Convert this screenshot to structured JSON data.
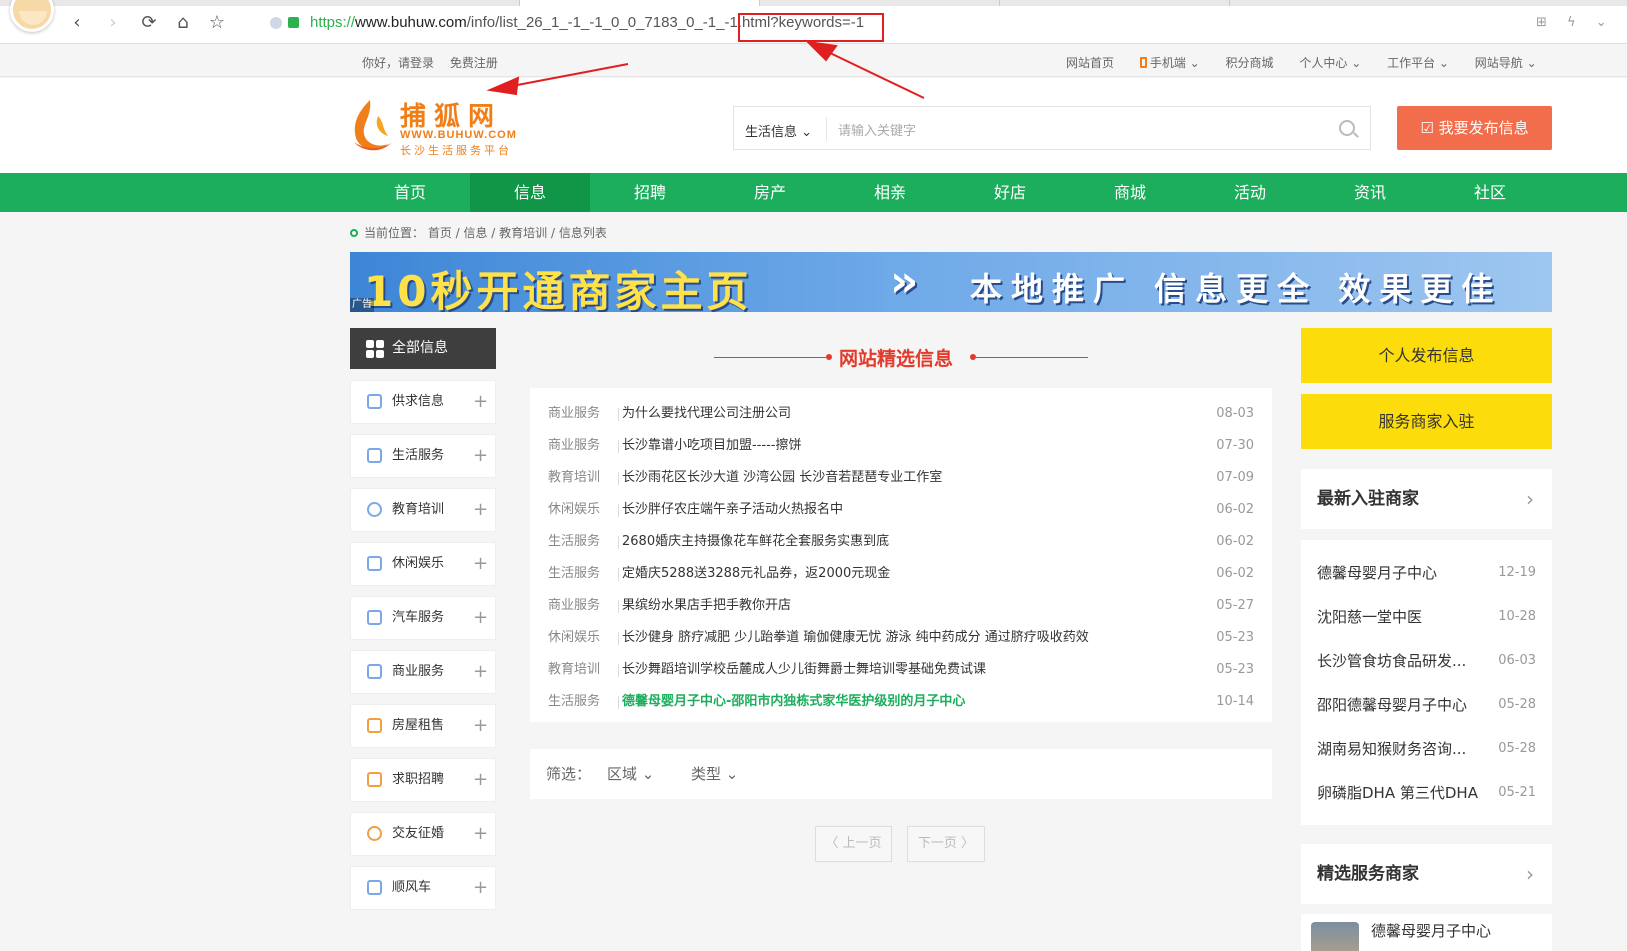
{
  "browser": {
    "url_scheme": "https://",
    "url_host": "www.buhuw.com",
    "url_path": "/info/list_26_1_-1_-1_0_0_7183_0_-1_-1.html?keywords=-1",
    "back_icon": "chevron-left-icon",
    "forward_icon": "chevron-right-icon",
    "reload_icon": "reload-icon",
    "home_icon": "home-icon",
    "star_icon": "star-icon",
    "right_tools": "⊞ ϟ ⌄"
  },
  "topbar": {
    "greeting": "你好，请登录",
    "register": "免费注册",
    "links": [
      "网站首页",
      "手机端 ⌄",
      "积分商城",
      "个人中心 ⌄",
      "工作平台 ⌄",
      "网站导航 ⌄"
    ]
  },
  "logo": {
    "name": "捕狐网",
    "domain": "WWW.BUHUW.COM",
    "slogan": "长沙生活服务平台"
  },
  "search": {
    "category": "生活信息 ⌄",
    "placeholder": "请输入关键字"
  },
  "publish_button": "☑ 我要发布信息",
  "mainnav": [
    "首页",
    "信息",
    "招聘",
    "房产",
    "相亲",
    "好店",
    "商城",
    "活动",
    "资讯",
    "社区"
  ],
  "mainnav_active": "信息",
  "breadcrumb": "当前位置：  首页 / 信息 / 教育培训 / 信息列表",
  "banner": {
    "headline": "10秒开通商家主页",
    "chevrons": "»",
    "tagline": "本地推广  信息更全  效果更佳",
    "ad_tag": "广告"
  },
  "sidebar": {
    "all_label": "全部信息",
    "items": [
      {
        "label": "供求信息",
        "icon": "store-icon"
      },
      {
        "label": "生活服务",
        "icon": "cup-icon"
      },
      {
        "label": "教育培训",
        "icon": "clock-icon"
      },
      {
        "label": "休闲娱乐",
        "icon": "microphone-icon"
      },
      {
        "label": "汽车服务",
        "icon": "car-icon"
      },
      {
        "label": "商业服务",
        "icon": "card-icon"
      },
      {
        "label": "房屋租售",
        "icon": "building-icon"
      },
      {
        "label": "求职招聘",
        "icon": "briefcase-icon"
      },
      {
        "label": "交友征婚",
        "icon": "people-icon"
      },
      {
        "label": "顺风车",
        "icon": "bus-icon"
      }
    ]
  },
  "section_title": "网站精选信息",
  "info_list": [
    {
      "cat": "商业服务",
      "title": "为什么要找代理公司注册公司",
      "date": "08-03"
    },
    {
      "cat": "商业服务",
      "title": "长沙靠谱小吃项目加盟-----擦饼",
      "date": "07-30"
    },
    {
      "cat": "教育培训",
      "title": "长沙雨花区长沙大道 沙湾公园 长沙音若琵琶专业工作室",
      "date": "07-09"
    },
    {
      "cat": "休闲娱乐",
      "title": "长沙胖仔农庄端午亲子活动火热报名中",
      "date": "06-02"
    },
    {
      "cat": "生活服务",
      "title": "2680婚庆主持摄像花车鲜花全套服务实惠到底",
      "date": "06-02"
    },
    {
      "cat": "生活服务",
      "title": "定婚庆5288送3288元礼品券，返2000元现金",
      "date": "06-02"
    },
    {
      "cat": "商业服务",
      "title": "果缤纷水果店手把手教你开店",
      "date": "05-27"
    },
    {
      "cat": "休闲娱乐",
      "title": "长沙健身 脐疗减肥 少儿跆拳道 瑜伽健康无忧 游泳 纯中药成分 通过脐疗吸收药效",
      "date": "05-23"
    },
    {
      "cat": "教育培训",
      "title": "长沙舞蹈培训学校岳麓成人少儿街舞爵士舞培训零基础免费试课",
      "date": "05-23"
    },
    {
      "cat": "生活服务",
      "title": "德馨母婴月子中心-邵阳市内独栋式家华医护级别的月子中心",
      "date": "10-14",
      "highlight": true
    }
  ],
  "filter": {
    "label": "筛选：",
    "region": "区域 ⌄",
    "type": "类型 ⌄"
  },
  "pager": {
    "prev": "〈 上一页",
    "next": "下一页 〉"
  },
  "right": {
    "btn_personal": "个人发布信息",
    "btn_merchant": "服务商家入驻",
    "latest_title": "最新入驻商家",
    "featured_title": "精选服务商家",
    "chevron": "›",
    "latest": [
      {
        "name": "德馨母婴月子中心",
        "date": "12-19"
      },
      {
        "name": "沈阳慈一堂中医",
        "date": "10-28"
      },
      {
        "name": "长沙管食坊食品研发...",
        "date": "06-03"
      },
      {
        "name": "邵阳德馨母婴月子中心",
        "date": "05-28"
      },
      {
        "name": "湖南易知猴财务咨询...",
        "date": "05-28"
      },
      {
        "name": "卵磷脂DHA 第三代DHA",
        "date": "05-21"
      }
    ],
    "featured_first": "德馨母婴月子中心"
  },
  "colors": {
    "green": "#1cae5c",
    "orange": "#f26d4b",
    "yellow": "#fddc0b",
    "red": "#e23b2b"
  }
}
